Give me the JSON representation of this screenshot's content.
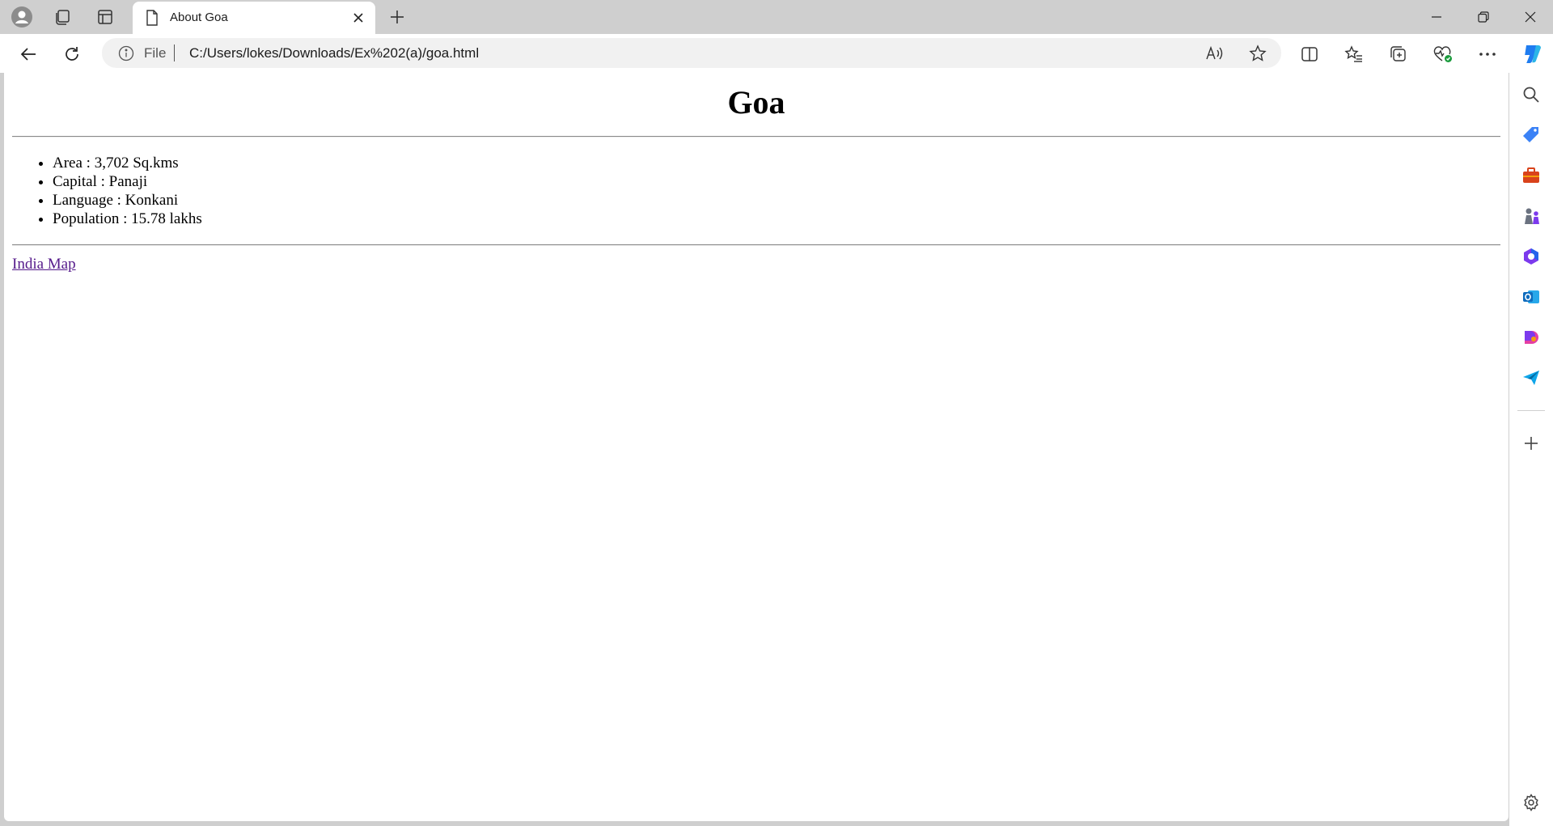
{
  "browser": {
    "tab": {
      "title": "About Goa"
    },
    "address": {
      "protocol_label": "File",
      "url": "C:/Users/lokes/Downloads/Ex%202(a)/goa.html"
    }
  },
  "page": {
    "heading": "Goa",
    "facts": [
      "Area : 3,702 Sq.kms",
      "Capital : Panaji",
      "Language : Konkani",
      "Population : 15.78 lakhs"
    ],
    "link_text": "India Map"
  },
  "colors": {
    "titlebar_bg": "#cfcfcf",
    "toolbar_bg": "#ffffff",
    "link_visited": "#551a8b",
    "copilot_blue": "#1f7cf0",
    "shopping_blue": "#3b82f6",
    "tools_red": "#d9431b",
    "outlook_blue": "#0f6cbd"
  },
  "icons": {
    "profile": "profile-icon",
    "workspaces": "workspaces-icon",
    "tab_actions": "tab-actions-icon",
    "page": "page-icon",
    "close": "close-icon",
    "new_tab": "plus-icon",
    "back": "back-arrow-icon",
    "refresh": "refresh-icon",
    "info": "info-icon",
    "read_aloud": "read-aloud-icon",
    "favorite": "star-icon",
    "split_screen": "split-screen-icon",
    "favorites": "favorites-icon",
    "collections": "collections-icon",
    "performance": "heart-pulse-icon",
    "more": "more-icon",
    "copilot": "copilot-icon",
    "sidebar": [
      "search-icon",
      "shopping-tag-icon",
      "tools-briefcase-icon",
      "games-icon",
      "m365-icon",
      "outlook-icon",
      "designer-icon",
      "send-icon",
      "add-icon",
      "settings-icon"
    ]
  }
}
